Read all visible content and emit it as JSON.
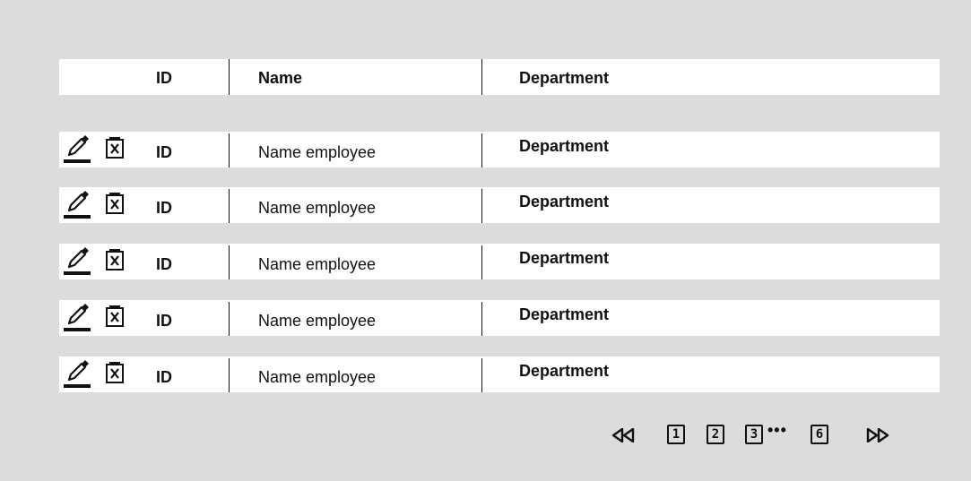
{
  "header": {
    "id_label": "ID",
    "name_label": "Name",
    "department_label": "Department"
  },
  "rows": [
    {
      "id": "ID",
      "name": "Name employee",
      "department": "Department"
    },
    {
      "id": "ID",
      "name": "Name employee",
      "department": "Department"
    },
    {
      "id": "ID",
      "name": "Name employee",
      "department": "Department"
    },
    {
      "id": "ID",
      "name": "Name employee",
      "department": "Department"
    },
    {
      "id": "ID",
      "name": "Name employee",
      "department": "Department"
    }
  ],
  "row_actions": [
    "edit-icon",
    "delete-icon"
  ],
  "pagination": {
    "first_icon": "double-left-arrow-icon",
    "pages": [
      "1",
      "2",
      "3"
    ],
    "ellipsis": "•••",
    "last_page": "6",
    "next_icon": "double-right-arrow-icon"
  },
  "colors": {
    "background": "#dcdcdc",
    "row_background": "#ffffff",
    "text": "#111111"
  }
}
